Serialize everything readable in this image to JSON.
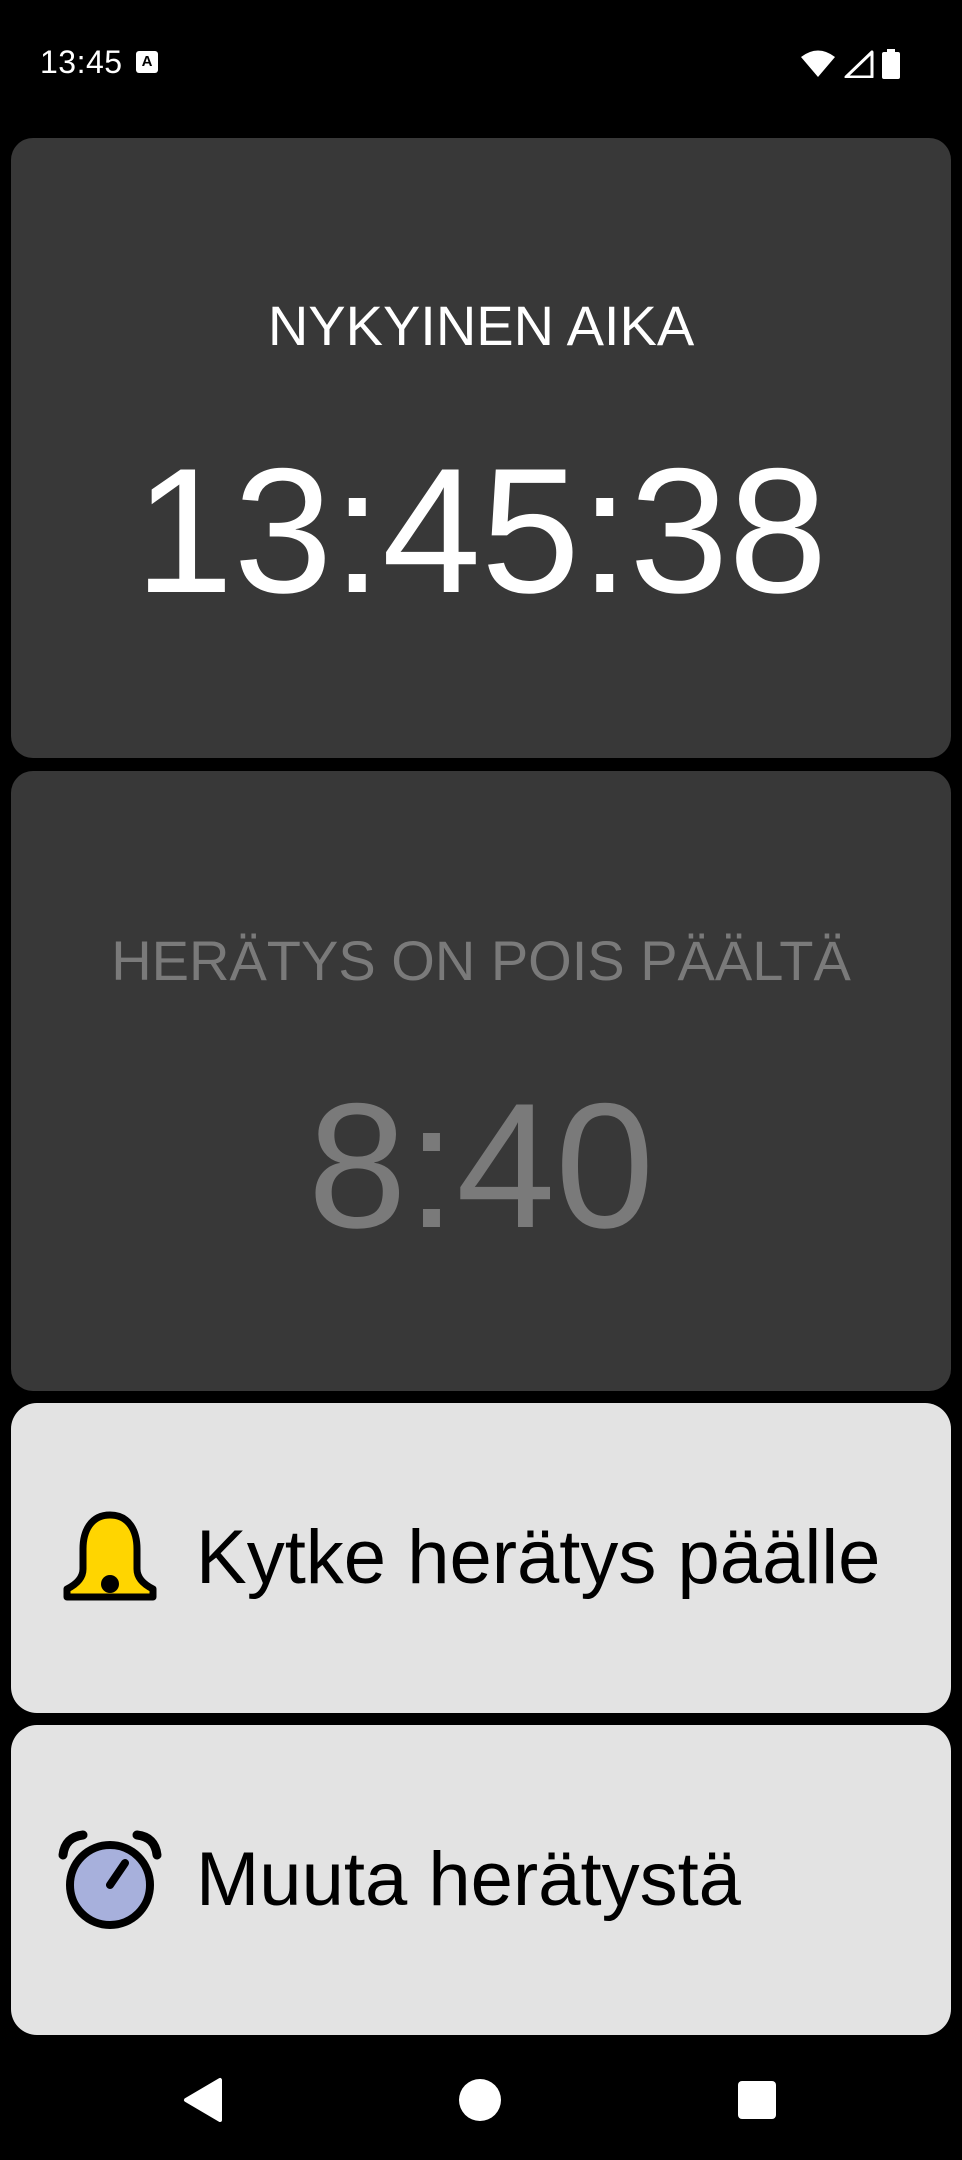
{
  "status_bar": {
    "time": "13:45",
    "notification_icon": "a-icon",
    "icons": [
      "wifi-icon",
      "signal-icon",
      "battery-icon"
    ]
  },
  "clock_card": {
    "title": "NYKYINEN AIKA",
    "time": "13:45:38"
  },
  "alarm_card": {
    "title": "HERÄTYS ON POIS PÄÄLTÄ",
    "time": "8:40",
    "state": "off"
  },
  "actions": {
    "toggle_label": "Kytke herätys päälle",
    "toggle_icon": "bell-icon",
    "change_label": "Muuta herätystä",
    "change_icon": "alarm-clock-icon"
  },
  "colors": {
    "card_dark": "#383838",
    "button_bg": "#e3e3e3",
    "bell_yellow": "#ffd500",
    "clock_face": "#a7b0dc",
    "disabled_text": "#7a7a7a"
  },
  "nav_bar": {
    "buttons": [
      "back-icon",
      "home-icon",
      "recents-icon"
    ]
  }
}
